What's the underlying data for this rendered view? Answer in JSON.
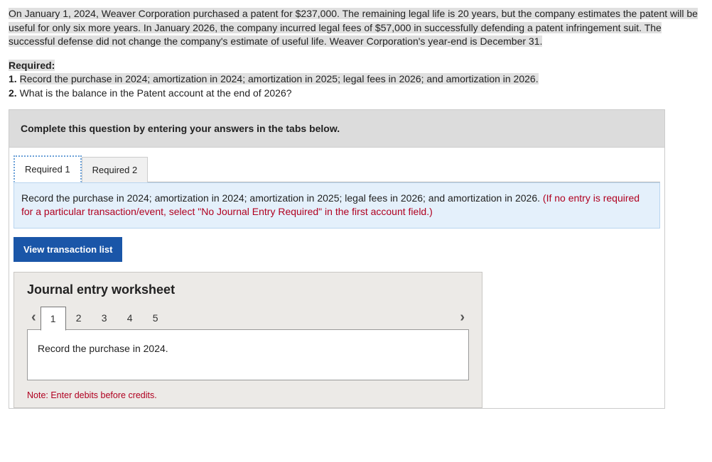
{
  "problem": {
    "text": "On January 1, 2024, Weaver Corporation purchased a patent for $237,000. The remaining legal life is 20 years, but the company estimates the patent will be useful for only six more years. In January 2026, the company incurred legal fees of $57,000 in successfully defending a patent infringement suit. The successful defense did not change the company's estimate of useful life. Weaver Corporation's year-end is December 31."
  },
  "required": {
    "heading": "Required:",
    "items": [
      {
        "num": "1.",
        "text": "Record the purchase in 2024; amortization in 2024; amortization in 2025; legal fees in 2026; and amortization in 2026."
      },
      {
        "num": "2.",
        "text": "What is the balance in the Patent account at the end of 2026?"
      }
    ]
  },
  "instruction": "Complete this question by entering your answers in the tabs below.",
  "tabs": [
    {
      "label": "Required 1",
      "active": true
    },
    {
      "label": "Required 2",
      "active": false
    }
  ],
  "tab_content": {
    "main": "Record the purchase in 2024; amortization in 2024; amortization in 2025; legal fees in 2026; and amortization in 2026. ",
    "red": "(If no entry is required for a particular transaction/event, select \"No Journal Entry Required\" in the first account field.)"
  },
  "view_btn": "View transaction list",
  "worksheet": {
    "title": "Journal entry worksheet",
    "steps": [
      "1",
      "2",
      "3",
      "4",
      "5"
    ],
    "active_step": 0,
    "body": "Record the purchase in 2024.",
    "note": "Note: Enter debits before credits."
  }
}
